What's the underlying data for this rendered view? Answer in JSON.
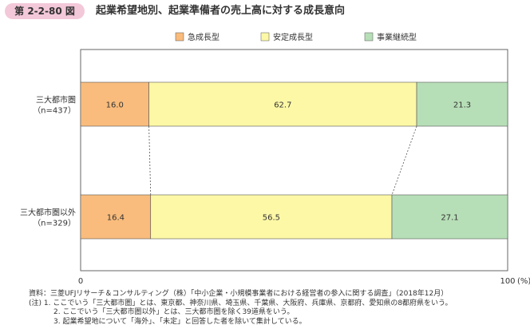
{
  "header": {
    "figure_number": "第 2-2-80 図",
    "title": "起業希望地別、起業準備者の売上高に対する成長意向"
  },
  "chart_data": {
    "type": "bar",
    "orientation": "horizontal",
    "stacked": true,
    "percent": true,
    "categories": [
      "三大都市圏\n（n=437）",
      "三大都市圏以外\n（n=329）"
    ],
    "category_lines": [
      [
        "三大都市圏",
        "（n=437）"
      ],
      [
        "三大都市圏以外",
        "（n=329）"
      ]
    ],
    "series": [
      {
        "name": "急成長型",
        "values": [
          16.0,
          16.4
        ],
        "labels": [
          "16.0",
          "16.4"
        ],
        "color": "#f9bc7c"
      },
      {
        "name": "安定成長型",
        "values": [
          62.7,
          56.5
        ],
        "labels": [
          "62.7",
          "56.5"
        ],
        "color": "#fdf8a6"
      },
      {
        "name": "事業継続型",
        "values": [
          21.3,
          27.1
        ],
        "labels": [
          "21.3",
          "27.1"
        ],
        "color": "#b7dfb7"
      }
    ],
    "xlim": [
      0,
      100
    ],
    "x_tick_labels": [
      "0",
      "100"
    ],
    "x_unit": "(%)",
    "legend_position": "top",
    "connector_lines": true
  },
  "notes": [
    "資料：三菱UFJリサーチ＆コンサルティング（株）「中小企業・小規模事業者における経営者の参入に関する調査」（2018年12月）",
    "(注) 1. ここでいう「三大都市圏」とは、東京都、神奈川県、埼玉県、千葉県、大阪府、兵庫県、京都府、愛知県の8都府県をいう。",
    "2. ここでいう「三大都市圏以外」とは、三大都市圏を除く39道県をいう。",
    "3. 起業希望地について「海外」、「未定」と回答した者を除いて集計している。"
  ],
  "colors": {
    "badge_bg": "#f3c8d8",
    "bar_stroke": "#555555",
    "frame": "#666666"
  }
}
